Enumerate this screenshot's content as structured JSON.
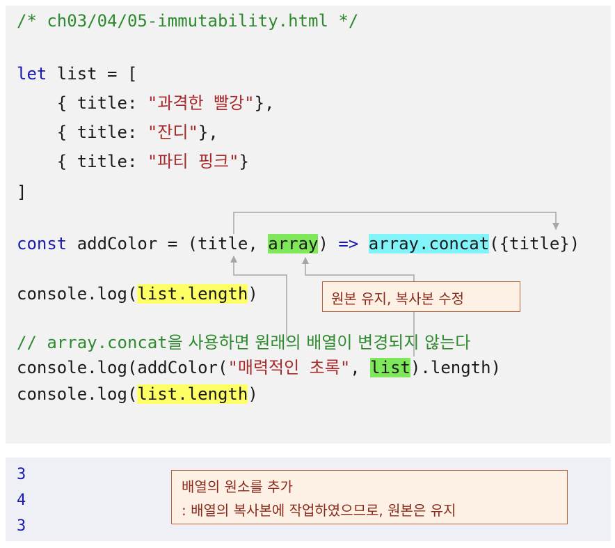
{
  "code": {
    "comment_header": "/* ch03/04/05-immutability.html */",
    "let_kw": "let",
    "list_decl": " list = [",
    "items": [
      {
        "prefix": "    { title: ",
        "value": "\"과격한 빨강\"",
        "suffix": "},"
      },
      {
        "prefix": "    { title: ",
        "value": "\"잔디\"",
        "suffix": "},"
      },
      {
        "prefix": "    { title: ",
        "value": "\"파티 핑크\"",
        "suffix": "}"
      }
    ],
    "close_bracket": "]",
    "const_kw": "const",
    "fn_part1": " addColor = (title, ",
    "fn_array": "array",
    "fn_arrow_pre": ") ",
    "fn_arrow": "=>",
    "fn_space": " ",
    "fn_concat": "array.concat",
    "fn_end": "({title})",
    "log1_pre": "console.log(",
    "log1_hl": "list.length",
    "log1_post": ")",
    "comment2_code": "// array.concat",
    "comment2_text": "을 사용하면 원래의 배열이 변경되지 않는다",
    "log2_pre": "console.log(addColor(",
    "log2_str": "\"매력적인 초록\"",
    "log2_mid": ", ",
    "log2_hl": "list",
    "log2_post": ").length)",
    "log3_pre": "console.log(",
    "log3_hl": "list.length",
    "log3_post": ")"
  },
  "output": [
    "3",
    "4",
    "3"
  ],
  "notes": {
    "note1": "원본 유지, 복사본 수정",
    "note2_line1": "배열의 원소를 추가",
    "note2_line2": ": 배열의 복사본에 작업하였으므로, 원본은 유지"
  },
  "colors": {
    "keyword": "#1a1ab0",
    "string": "#a62a2a",
    "comment": "#2e8a2e",
    "highlight_yellow": "#ffff66",
    "highlight_green": "#7ee85a",
    "highlight_cyan": "#80f4f8",
    "arrow": "#999999"
  }
}
